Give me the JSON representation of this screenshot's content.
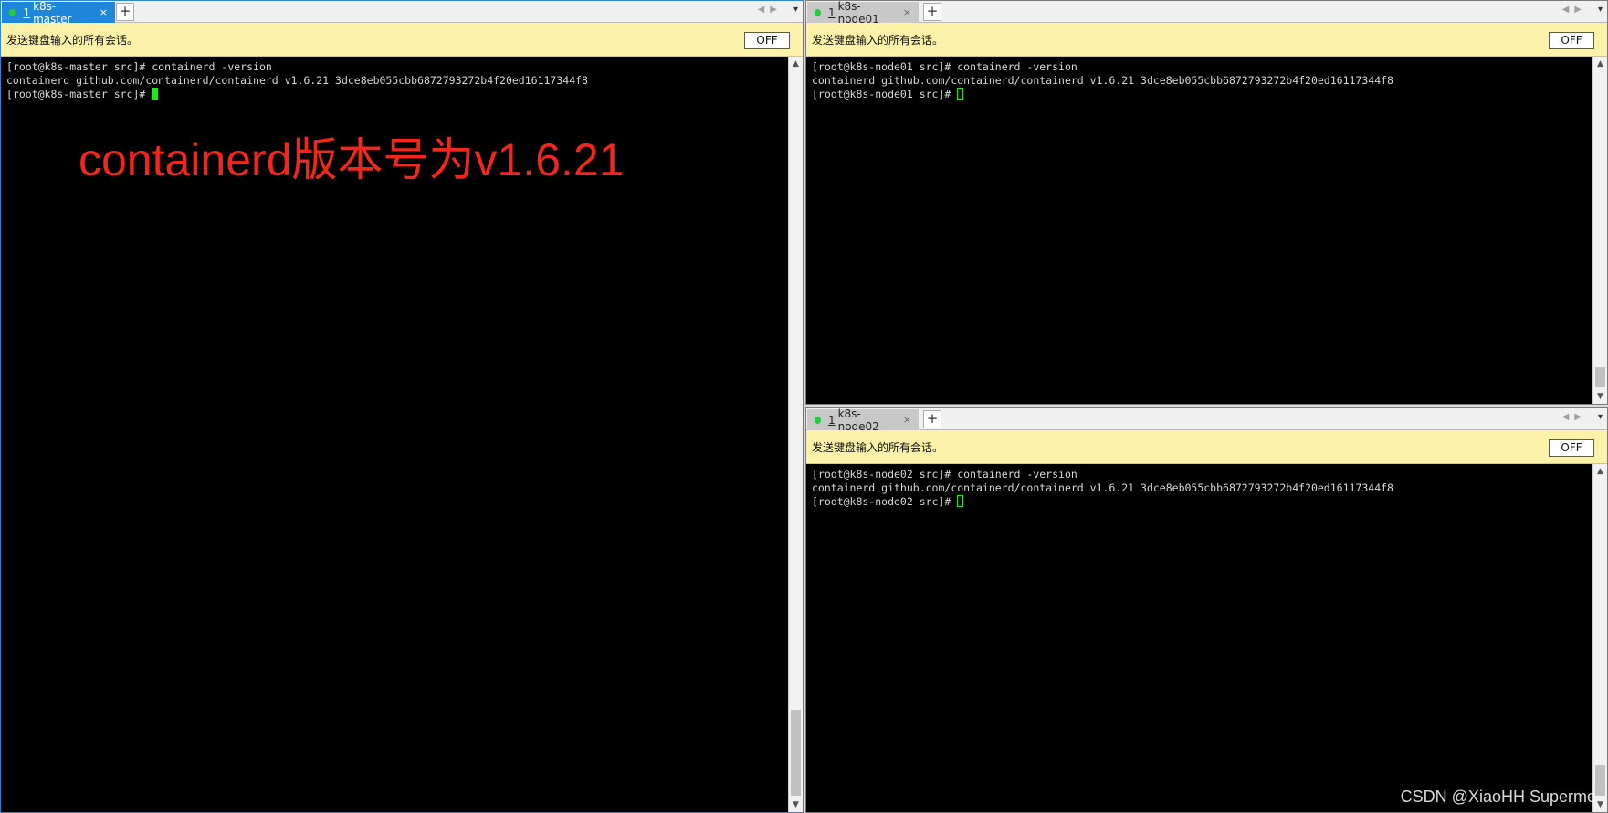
{
  "broadcast_text": "发送键盘输入的所有会话。",
  "off_label": "OFF",
  "panes": {
    "master": {
      "tab_number": "1",
      "tab_label": "k8s-master",
      "close_glyph": "×",
      "lines": [
        "[root@k8s-master src]# containerd -version",
        "containerd github.com/containerd/containerd v1.6.21 3dce8eb055cbb6872793272b4f20ed16117344f8"
      ],
      "prompt": "[root@k8s-master src]# "
    },
    "node01": {
      "tab_number": "1",
      "tab_label": "k8s-node01",
      "close_glyph": "×",
      "lines": [
        "[root@k8s-node01 src]# containerd -version",
        "containerd github.com/containerd/containerd v1.6.21 3dce8eb055cbb6872793272b4f20ed16117344f8"
      ],
      "prompt": "[root@k8s-node01 src]# "
    },
    "node02": {
      "tab_number": "1",
      "tab_label": "k8s-node02",
      "close_glyph": "×",
      "lines": [
        "[root@k8s-node02 src]# containerd -version",
        "containerd github.com/containerd/containerd v1.6.21 3dce8eb055cbb6872793272b4f20ed16117344f8"
      ],
      "prompt": "[root@k8s-node02 src]# "
    }
  },
  "new_tab_glyph": "+",
  "nav_glyphs": "◀▶",
  "menu_glyph": "▾",
  "scroll_up_glyph": "▲",
  "scroll_down_glyph": "▼",
  "annotation": "containerd版本号为v1.6.21",
  "watermark": "CSDN @XiaoHH Superme",
  "colors": {
    "active_tab": "#1f86d9",
    "broadcast_bar": "#fbf1a8",
    "cursor": "#28e228",
    "annotation": "#f0271c",
    "session_dot": "#27c93f"
  }
}
